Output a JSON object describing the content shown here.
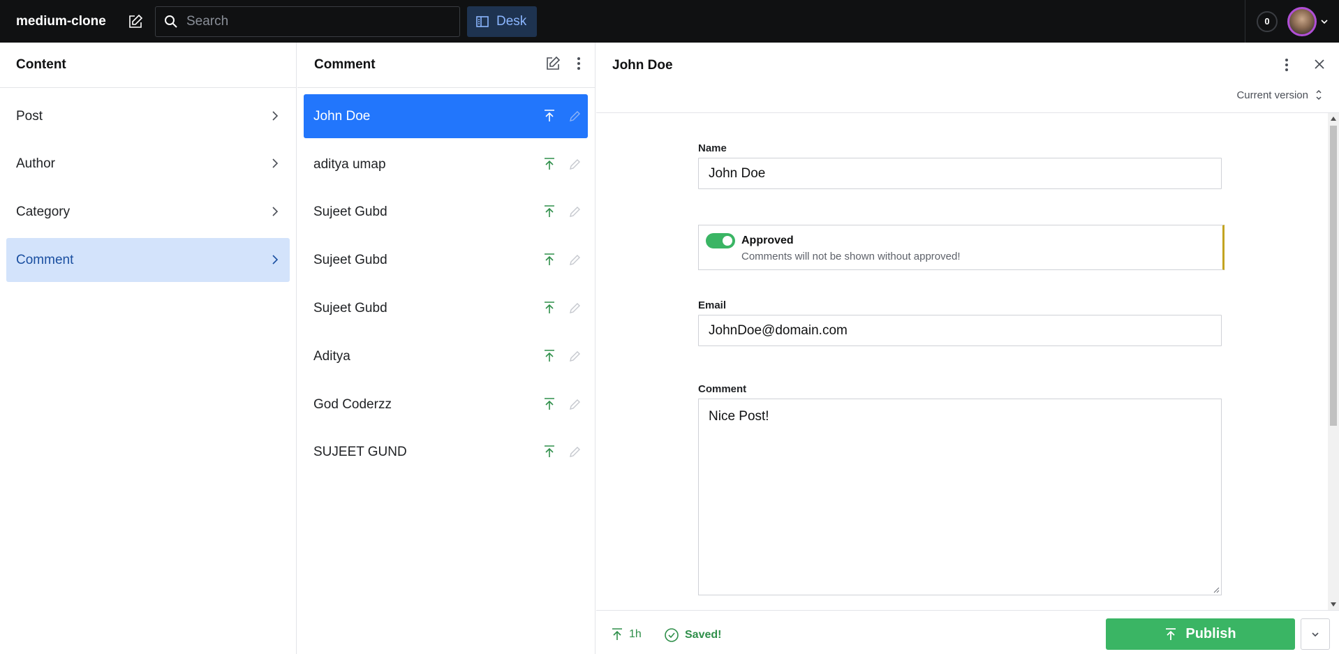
{
  "topbar": {
    "brand": "medium-clone",
    "search_placeholder": "Search",
    "desk_label": "Desk",
    "notification_count": "0"
  },
  "content_pane": {
    "title": "Content",
    "items": [
      {
        "label": "Post"
      },
      {
        "label": "Author"
      },
      {
        "label": "Category"
      },
      {
        "label": "Comment"
      }
    ],
    "active_index": 3
  },
  "comment_pane": {
    "title": "Comment",
    "items": [
      {
        "label": "John Doe"
      },
      {
        "label": "aditya umap"
      },
      {
        "label": "Sujeet Gubd"
      },
      {
        "label": "Sujeet Gubd"
      },
      {
        "label": "Sujeet Gubd"
      },
      {
        "label": "Aditya"
      },
      {
        "label": "God Coderzz"
      },
      {
        "label": "SUJEET GUND"
      }
    ],
    "active_index": 0
  },
  "document": {
    "title": "John Doe",
    "version_label": "Current version",
    "fields": {
      "name_label": "Name",
      "name_value": "John Doe",
      "approved_label": "Approved",
      "approved_desc": "Comments will not be shown without approved!",
      "approved_on": true,
      "email_label": "Email",
      "email_value": "JohnDoe@domain.com",
      "comment_label": "Comment",
      "comment_value": "Nice Post!"
    },
    "footer": {
      "published_ago": "1h",
      "saved_label": "Saved!",
      "publish_label": "Publish"
    }
  },
  "colors": {
    "topbar_bg": "#101112",
    "accent_blue": "#2276fc",
    "nav_active_bg": "#d3e3fb",
    "publish_green": "#3ab564",
    "status_green": "#2f8f4a",
    "validation_yellow": "#c3a421"
  }
}
